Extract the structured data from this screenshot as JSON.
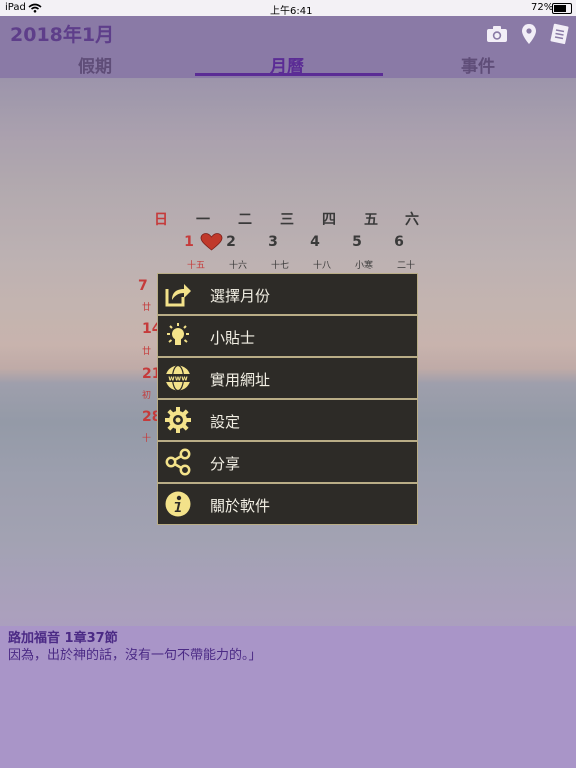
{
  "status_bar": {
    "device": "iPad",
    "time": "上午6:41",
    "battery": "72%"
  },
  "header": {
    "title": "2018年1月",
    "icons": [
      "camera-icon",
      "location-pin-icon",
      "notes-icon"
    ],
    "tabs": [
      {
        "label": "假期",
        "active": false
      },
      {
        "label": "月曆",
        "active": true
      },
      {
        "label": "事件",
        "active": false
      }
    ]
  },
  "calendar": {
    "weekdays": [
      "日",
      "一",
      "二",
      "三",
      "四",
      "五",
      "六"
    ],
    "week1": {
      "days": [
        "1",
        "2",
        "3",
        "4",
        "5",
        "6"
      ],
      "lunar": [
        "十五",
        "十六",
        "十七",
        "十八",
        "小寒",
        "二十"
      ]
    },
    "left_days": [
      "7",
      "14",
      "21",
      "28"
    ],
    "left_lunar": [
      "廿",
      "廿",
      "初",
      "十"
    ]
  },
  "menu": {
    "items": [
      {
        "label": "選擇月份",
        "icon": "external-link-icon"
      },
      {
        "label": "小貼士",
        "icon": "lightbulb-icon"
      },
      {
        "label": "實用網址",
        "icon": "globe-www-icon"
      },
      {
        "label": "設定",
        "icon": "gear-icon"
      },
      {
        "label": "分享",
        "icon": "share-icon"
      },
      {
        "label": "關於軟件",
        "icon": "info-icon"
      }
    ]
  },
  "verse": {
    "reference": "路加福音 1章37節",
    "text": "因為，出於神的話，沒有一句不帶能力的。」"
  },
  "colors": {
    "menu_bg": "#2d2b27",
    "menu_border": "#b9ad86",
    "icon_yellow": "#f3e28a",
    "accent": "#5b2c95"
  }
}
